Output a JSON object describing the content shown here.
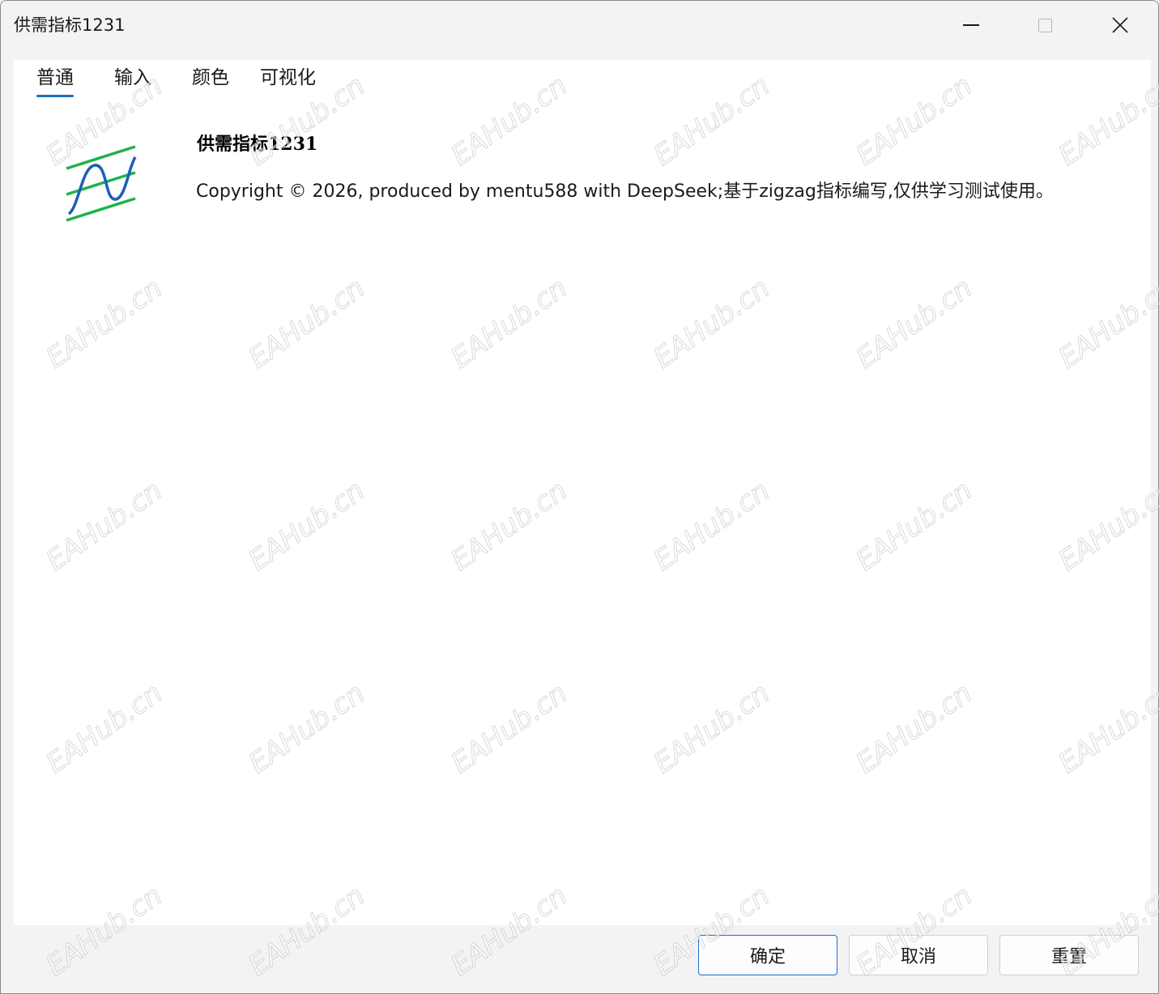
{
  "window": {
    "title": "供需指标1231",
    "minimize_icon": "minimize-icon",
    "maximize_icon": "maximize-icon",
    "close_icon": "close-icon"
  },
  "tabs": [
    {
      "label": "普通",
      "active": true
    },
    {
      "label": "输入",
      "active": false
    },
    {
      "label": "颜色",
      "active": false
    },
    {
      "label": "可视化",
      "active": false
    }
  ],
  "general": {
    "logo_icon": "indicator-wave-icon",
    "indicator_name": "供需指标1231",
    "copyright": "Copyright © 2026, produced by mentu588 with DeepSeek;基于zigzag指标编写,仅供学习测试使用。"
  },
  "footer": {
    "ok_label": "确定",
    "cancel_label": "取消",
    "reset_label": "重置"
  },
  "watermark": {
    "text": "EAHub.cn"
  },
  "colors": {
    "accent": "#1a6fc4",
    "logo_green": "#1fb24a",
    "logo_blue": "#1a5fb4"
  }
}
